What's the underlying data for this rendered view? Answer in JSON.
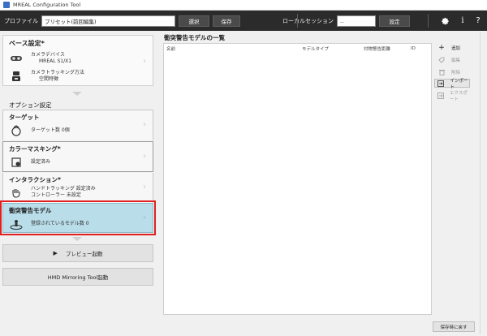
{
  "window": {
    "title": "MREAL Configuration Tool"
  },
  "toolbar": {
    "profile_label": "プロファイル",
    "profile_value": "プリセット(前回編集)",
    "select_label": "選択",
    "save_label": "保存",
    "session_label": "ローカルセッション",
    "session_value": "--",
    "settings_label": "設定",
    "icons": [
      "gear-icon",
      "info-icon",
      "help-icon"
    ]
  },
  "base": {
    "title": "ベース設定*",
    "camera_device_label": "カメラデバイス",
    "camera_device_value": "MREAL S1/X1",
    "tracking_label": "カメラトラッキング方法",
    "tracking_value": "空間特徴"
  },
  "options": {
    "title": "オプション設定",
    "target": {
      "title": "ターゲット",
      "text": "ターゲット数 0個"
    },
    "color_masking": {
      "title": "カラーマスキング*",
      "text": "設定済み"
    },
    "interaction": {
      "title": "インタラクション*",
      "line1": "ハンドトラッキング  設定済み",
      "line2": "コントローラー  未設定"
    },
    "collision": {
      "title": "衝突警告モデル",
      "text": "登録されているモデル数 0"
    }
  },
  "buttons": {
    "preview": "プレビュー起動",
    "hmd": "HMD Mirroring Tool起動",
    "back": "保存時に戻す"
  },
  "list": {
    "title": "衝突警告モデルの一覧",
    "columns": [
      "名前",
      "モデルタイプ",
      "対物警告距離",
      "ID"
    ]
  },
  "side_actions": [
    {
      "label": "追加",
      "icon": "plus-icon",
      "enabled": true
    },
    {
      "label": "編集",
      "icon": "tag-icon",
      "enabled": false
    },
    {
      "label": "削除",
      "icon": "trash-icon",
      "enabled": false
    },
    {
      "label": "インポート",
      "icon": "import-icon",
      "enabled": true
    },
    {
      "label": "エクスポート",
      "icon": "export-icon",
      "enabled": false
    }
  ],
  "colors": {
    "active_card": "#b9dde9",
    "highlight_border": "#e02020",
    "toolbar": "#2b2b2b"
  }
}
